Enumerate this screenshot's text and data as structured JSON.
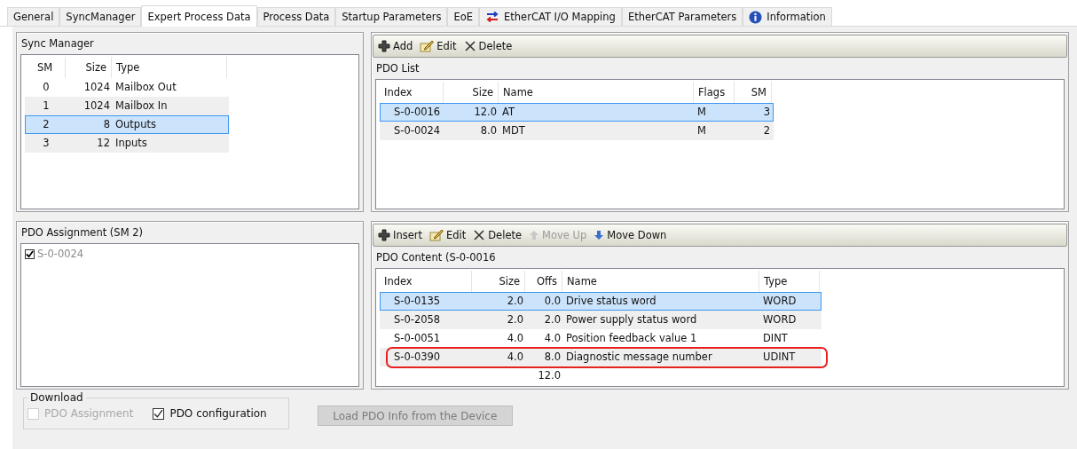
{
  "tabs": [
    {
      "label": "General",
      "selected": false,
      "kind": "plain"
    },
    {
      "label": "SyncManager",
      "selected": false,
      "kind": "plain"
    },
    {
      "label": "Expert Process Data",
      "selected": true,
      "kind": "plain"
    },
    {
      "label": "Process Data",
      "selected": false,
      "kind": "plain"
    },
    {
      "label": "Startup Parameters",
      "selected": false,
      "kind": "plain"
    },
    {
      "label": "EoE",
      "selected": false,
      "kind": "plain"
    },
    {
      "label": "EtherCAT I/O Mapping",
      "selected": false,
      "kind": "arrows"
    },
    {
      "label": "EtherCAT Parameters",
      "selected": false,
      "kind": "plain"
    },
    {
      "label": "Information",
      "selected": false,
      "kind": "info"
    }
  ],
  "sync_manager": {
    "title": "Sync Manager",
    "columns": [
      "SM",
      "Size",
      "Type"
    ],
    "rows": [
      {
        "cells": [
          "0",
          "1024",
          "Mailbox Out"
        ],
        "selected": false
      },
      {
        "cells": [
          "1",
          "1024",
          "Mailbox In"
        ],
        "selected": false
      },
      {
        "cells": [
          "2",
          "8",
          "Outputs"
        ],
        "selected": true
      },
      {
        "cells": [
          "3",
          "12",
          "Inputs"
        ],
        "selected": false
      }
    ]
  },
  "pdo_list": {
    "toolbar": [
      {
        "label": "Add",
        "kind": "plus",
        "disabled": false
      },
      {
        "label": "Edit",
        "kind": "edit",
        "disabled": false
      },
      {
        "label": "Delete",
        "kind": "delete",
        "disabled": false
      }
    ],
    "title": "PDO List",
    "columns": [
      "Index",
      "Size",
      "Name",
      "Flags",
      "SM"
    ],
    "rows": [
      {
        "cells": [
          "S-0-0016",
          "12.0",
          "AT",
          "M",
          "3"
        ],
        "selected": true
      },
      {
        "cells": [
          "S-0-0024",
          "8.0",
          "MDT",
          "M",
          "2"
        ],
        "selected": false
      }
    ]
  },
  "pdo_assignment": {
    "title": "PDO Assignment (SM 2)",
    "items": [
      {
        "label": "S-0-0024",
        "checked": true,
        "disabled": true
      }
    ]
  },
  "pdo_content": {
    "toolbar": [
      {
        "label": "Insert",
        "kind": "plus",
        "disabled": false
      },
      {
        "label": "Edit",
        "kind": "edit",
        "disabled": false
      },
      {
        "label": "Delete",
        "kind": "delete",
        "disabled": false
      },
      {
        "label": "Move Up",
        "kind": "up",
        "disabled": true
      },
      {
        "label": "Move Down",
        "kind": "down",
        "disabled": false
      }
    ],
    "title": "PDO Content (S-0-0016",
    "columns": [
      "Index",
      "Size",
      "Offs",
      "Name",
      "Type"
    ],
    "rows": [
      {
        "cells": [
          "S-0-0135",
          "2.0",
          "0.0",
          "Drive status word",
          "WORD"
        ],
        "selected": true,
        "highlighted": false
      },
      {
        "cells": [
          "S-0-2058",
          "2.0",
          "2.0",
          "Power supply status word",
          "WORD"
        ],
        "selected": false,
        "highlighted": false
      },
      {
        "cells": [
          "S-0-0051",
          "4.0",
          "4.0",
          "Position feedback value 1",
          "DINT"
        ],
        "selected": false,
        "highlighted": false
      },
      {
        "cells": [
          "S-0-0390",
          "4.0",
          "8.0",
          "Diagnostic message number",
          "UDINT"
        ],
        "selected": false,
        "highlighted": true
      }
    ],
    "total": "12.0"
  },
  "download": {
    "title": "Download",
    "options": [
      {
        "label": "PDO Assignment",
        "checked": false,
        "disabled": true
      },
      {
        "label": "PDO configuration",
        "checked": true,
        "disabled": false
      }
    ]
  },
  "load_button": {
    "label": "Load PDO Info from the Device",
    "disabled": true
  }
}
